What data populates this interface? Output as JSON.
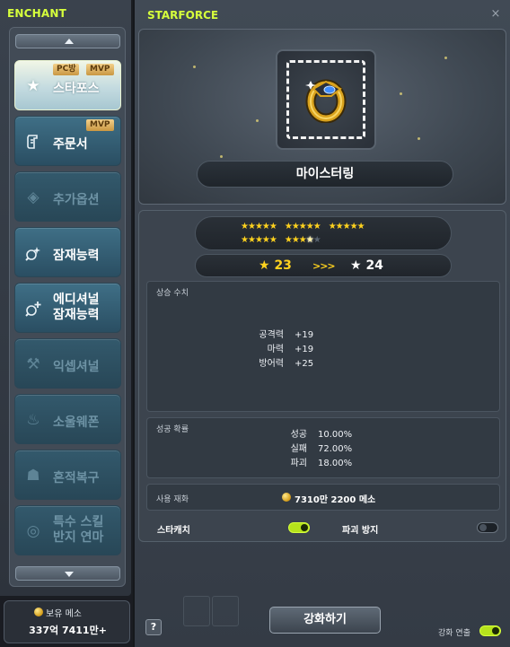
{
  "left_panel": {
    "title": "ENCHANT",
    "menu": [
      {
        "label": "스타포스",
        "icon": "star-icon",
        "glyph": "★",
        "badges": [
          "PC방",
          "MVP"
        ],
        "state": "active"
      },
      {
        "label": "주문서",
        "icon": "scroll-icon",
        "glyph": "📜",
        "badges": [
          "MVP"
        ],
        "state": "normal"
      },
      {
        "label": "추가옵션",
        "icon": "gem-icon",
        "glyph": "◈",
        "badges": [],
        "state": "disabled"
      },
      {
        "label": "잠재능력",
        "icon": "magnifier-sparkle-icon",
        "glyph": "✧",
        "badges": [],
        "state": "normal"
      },
      {
        "label": "에디셔널",
        "label2": "잠재능력",
        "icon": "magnifier-plus-icon",
        "glyph": "✚",
        "badges": [],
        "state": "normal"
      },
      {
        "label": "익셉셔널",
        "icon": "hammer-icon",
        "glyph": "⚒",
        "badges": [],
        "state": "disabled"
      },
      {
        "label": "소울웨폰",
        "icon": "flame-icon",
        "glyph": "♨",
        "badges": [],
        "state": "disabled"
      },
      {
        "label": "흔적복구",
        "icon": "figures-icon",
        "glyph": "☗",
        "badges": [],
        "state": "disabled"
      },
      {
        "label": "특수 스킬",
        "label2": "반지 연마",
        "icon": "ring-icon",
        "glyph": "◎",
        "badges": [],
        "state": "disabled"
      }
    ],
    "meso_label": "보유 메소",
    "meso_value": "337억 7411만+"
  },
  "starforce": {
    "title": "STARFORCE",
    "close": "×",
    "item_name": "마이스터링",
    "stars_filled": 23,
    "stars_total": 25,
    "current_level": "23",
    "arrow": ">>>",
    "next_level": "24",
    "stat_title": "상승 수치",
    "stats": [
      {
        "name": "공격력",
        "value": "+19"
      },
      {
        "name": "마력",
        "value": "+19"
      },
      {
        "name": "방어력",
        "value": "+25"
      }
    ],
    "prob_title": "성공 확률",
    "probs": [
      {
        "name": "성공",
        "value": "10.00%"
      },
      {
        "name": "실패",
        "value": "72.00%"
      },
      {
        "name": "파괴",
        "value": "18.00%"
      }
    ],
    "cost_label": "사용 재화",
    "cost_value": "7310만 2200 메소",
    "star_catch_label": "스타캐치",
    "star_catch_on": true,
    "destroy_prevent_label": "파괴 방지",
    "destroy_prevent_on": false,
    "help": "?",
    "enhance_button": "강화하기",
    "effect_label": "강화 연출",
    "effect_on": true
  },
  "colors": {
    "accent": "#d6ff3c",
    "star_gold": "#ffd21e",
    "toggle_on": "#b6e21c"
  }
}
